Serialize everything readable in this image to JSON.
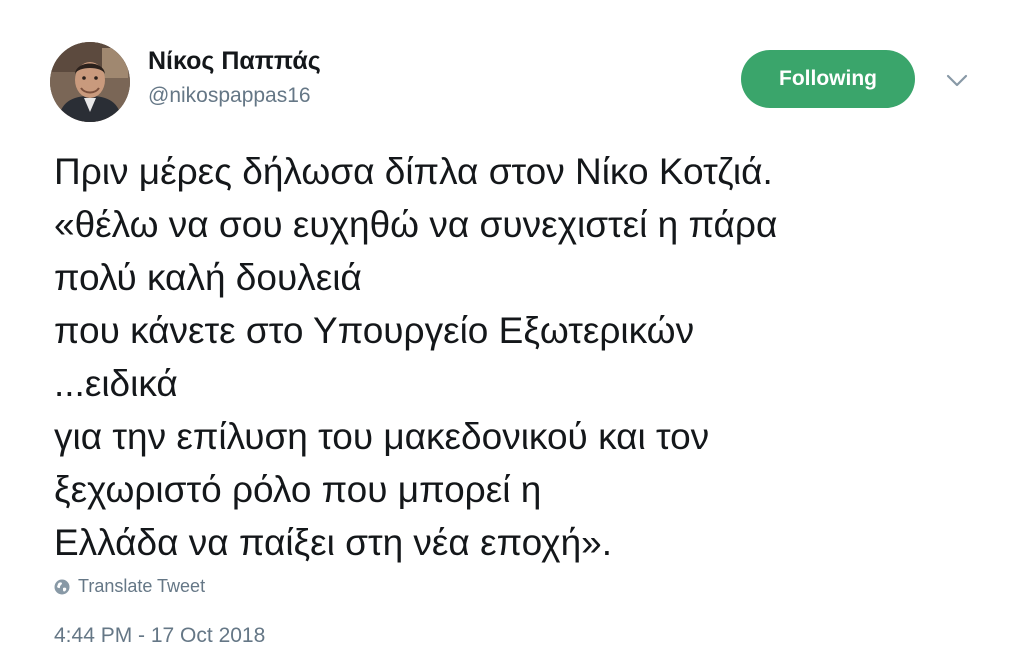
{
  "user": {
    "display_name": "Νίκος Παππάς",
    "handle": "@nikospappas16",
    "avatar_icon": "profile-photo"
  },
  "follow_button": {
    "label": "Following",
    "color": "#3aa56b"
  },
  "menu": {
    "icon": "chevron-down-icon"
  },
  "tweet": {
    "lines": [
      "Πριν μέρες δήλωσα δίπλα στον Νίκο Κοτζιά.",
      "«θέλω να σου ευχηθώ να συνεχιστεί η πάρα",
      "πολύ καλή δουλειά",
      "που κάνετε στο Υπουργείο Εξωτερικών",
      "...ειδικά",
      "για την επίλυση του μακεδονικού και τον",
      "ξεχωριστό ρόλο που μπορεί η",
      "Ελλάδα να παίξει στη νέα εποχή»."
    ]
  },
  "translate": {
    "label": "Translate Tweet",
    "icon": "globe-icon"
  },
  "timestamp": "4:44 PM - 17 Oct 2018"
}
